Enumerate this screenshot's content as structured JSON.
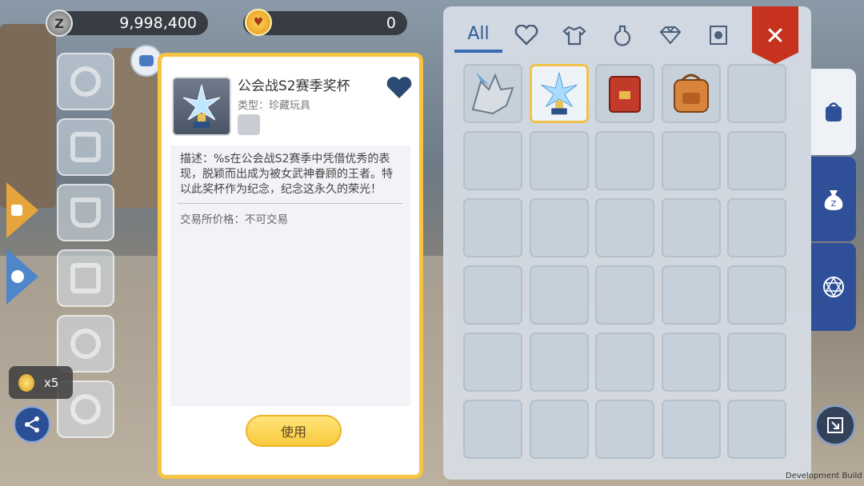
{
  "hud": {
    "zeny_amount": "9,998,400",
    "zeny_icon": "zeny-coin-icon",
    "secondary_amount": "0",
    "secondary_icon": "cat-coin-icon"
  },
  "item_detail": {
    "name": "公会战S2赛季奖杯",
    "type": "类型：珍藏玩具",
    "description": "描述：%s在公会战S2赛季中凭借优秀的表现，脱颖而出成为被女武神眷顾的王者。特以此奖杯作为纪念，纪念这永久的荣光！",
    "trade_price": "交易所价格：不可交易",
    "use_button": "使用",
    "favorite_icon": "heart-icon"
  },
  "inventory": {
    "tab_all_label": "All",
    "tab_icons": [
      "heart-icon",
      "armor-icon",
      "potion-icon",
      "gem-icon",
      "card-icon"
    ],
    "slots": [
      {
        "icon": "wolf-card-icon",
        "selected": false
      },
      {
        "icon": "trophy-icon",
        "selected": true
      },
      {
        "icon": "red-book-icon",
        "selected": false
      },
      {
        "icon": "backpack-item-icon",
        "selected": false
      }
    ],
    "total_slots": 30
  },
  "right_tabs": [
    "backpack-icon",
    "zeny-bag-icon",
    "magic-circle-icon"
  ],
  "badge": {
    "count": "x5",
    "icon": "gold-coin-icon"
  },
  "dev_build": "Development Build",
  "colors": {
    "accent_gold": "#f5c443",
    "close_red": "#c7321e",
    "tab_blue": "#2f4f98"
  }
}
